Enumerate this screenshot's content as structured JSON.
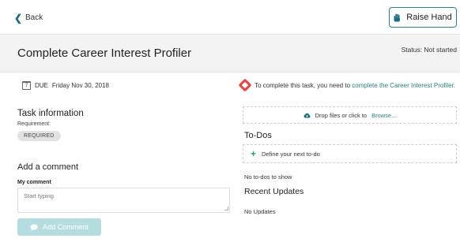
{
  "nav": {
    "back_label": "Back",
    "raise_hand_label": "Raise Hand"
  },
  "task": {
    "title": "Complete Career Interest Profiler",
    "status": "Status: Not started",
    "due_prefix": "DUE",
    "due_date": "Friday Nov 30, 2018",
    "notice_text": "To complete this task, you need to",
    "notice_link": "complete the Career Interest Profiler."
  },
  "task_info": {
    "heading": "Task information",
    "requirement_label": "Requirement:",
    "requirement_value": "REQUIRED"
  },
  "comment": {
    "heading": "Add a comment",
    "field_label": "My comment",
    "placeholder": "Start typing",
    "button_label": "Add Comment"
  },
  "upload": {
    "text": "Drop files or click to",
    "link": "Browse..."
  },
  "todos": {
    "heading": "To-Dos",
    "define_label": "Define your next to-do",
    "empty_text": "No to-dos to show"
  },
  "recent": {
    "heading": "Recent Updates",
    "empty_text": "No Updates"
  },
  "icons": {
    "back": "chevron-left-icon",
    "raise": "hand-icon",
    "calendar": "calendar-icon",
    "notice": "diamond-alert-icon",
    "upload": "cloud-upload-icon",
    "plus": "plus-icon",
    "comment": "speech-bubble-icon"
  },
  "colors": {
    "accent": "#2a7f86",
    "alert": "#e84545",
    "button_disabled": "#b5dde0",
    "plus": "#2a9d62"
  }
}
